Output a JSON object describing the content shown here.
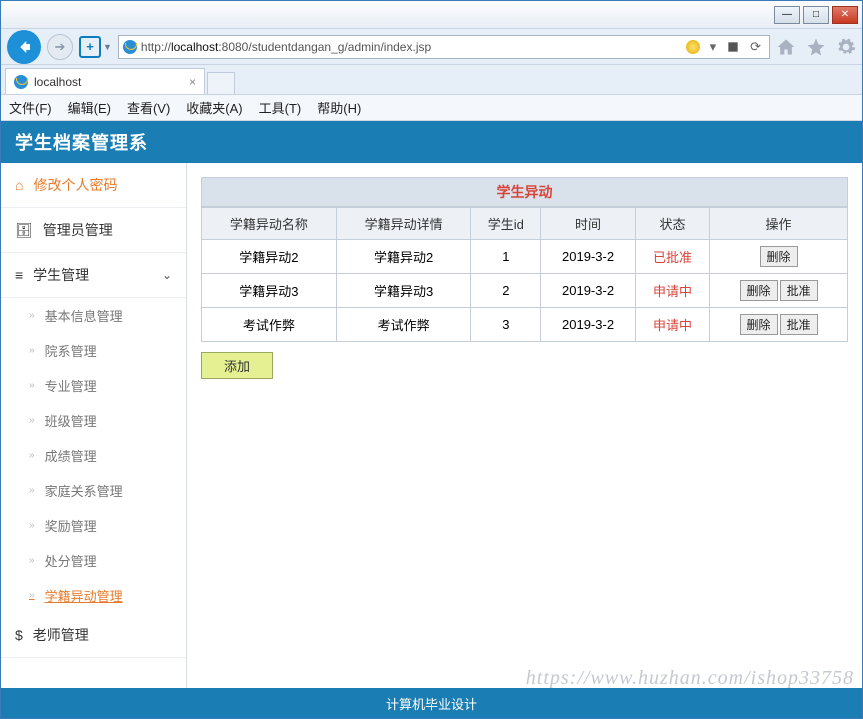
{
  "window": {
    "min_tip": "—",
    "max_tip": "□",
    "close_tip": "✕"
  },
  "address": {
    "url_prefix": "http://",
    "host": "localhost",
    "url_suffix": ":8080/studentdangan_g/admin/index.jsp",
    "dropdown": "▾",
    "refresh": "⟳"
  },
  "tab": {
    "title": "localhost",
    "close": "×"
  },
  "menus": [
    "文件(F)",
    "编辑(E)",
    "查看(V)",
    "收藏夹(A)",
    "工具(T)",
    "帮助(H)"
  ],
  "app_title": "学生档案管理系",
  "sidebar": {
    "password": "修改个人密码",
    "admin": "管理员管理",
    "student": "学生管理",
    "subs": [
      "基本信息管理",
      "院系管理",
      "专业管理",
      "班级管理",
      "成绩管理",
      "家庭关系管理",
      "奖励管理",
      "处分管理",
      "学籍异动管理"
    ],
    "teacher": "老师管理"
  },
  "panel": {
    "title": "学生异动",
    "headers": [
      "学籍异动名称",
      "学籍异动详情",
      "学生id",
      "时间",
      "状态",
      "操作"
    ],
    "rows": [
      {
        "name": "学籍异动2",
        "detail": "学籍异动2",
        "sid": "1",
        "time": "2019-3-2",
        "status": "已批准",
        "ops": [
          "删除"
        ]
      },
      {
        "name": "学籍异动3",
        "detail": "学籍异动3",
        "sid": "2",
        "time": "2019-3-2",
        "status": "申请中",
        "ops": [
          "删除",
          "批准"
        ]
      },
      {
        "name": "考试作弊",
        "detail": "考试作弊",
        "sid": "3",
        "time": "2019-3-2",
        "status": "申请中",
        "ops": [
          "删除",
          "批准"
        ]
      }
    ],
    "add": "添加"
  },
  "footer": "计算机毕业设计",
  "watermark": "https://www.huzhan.com/ishop33758"
}
